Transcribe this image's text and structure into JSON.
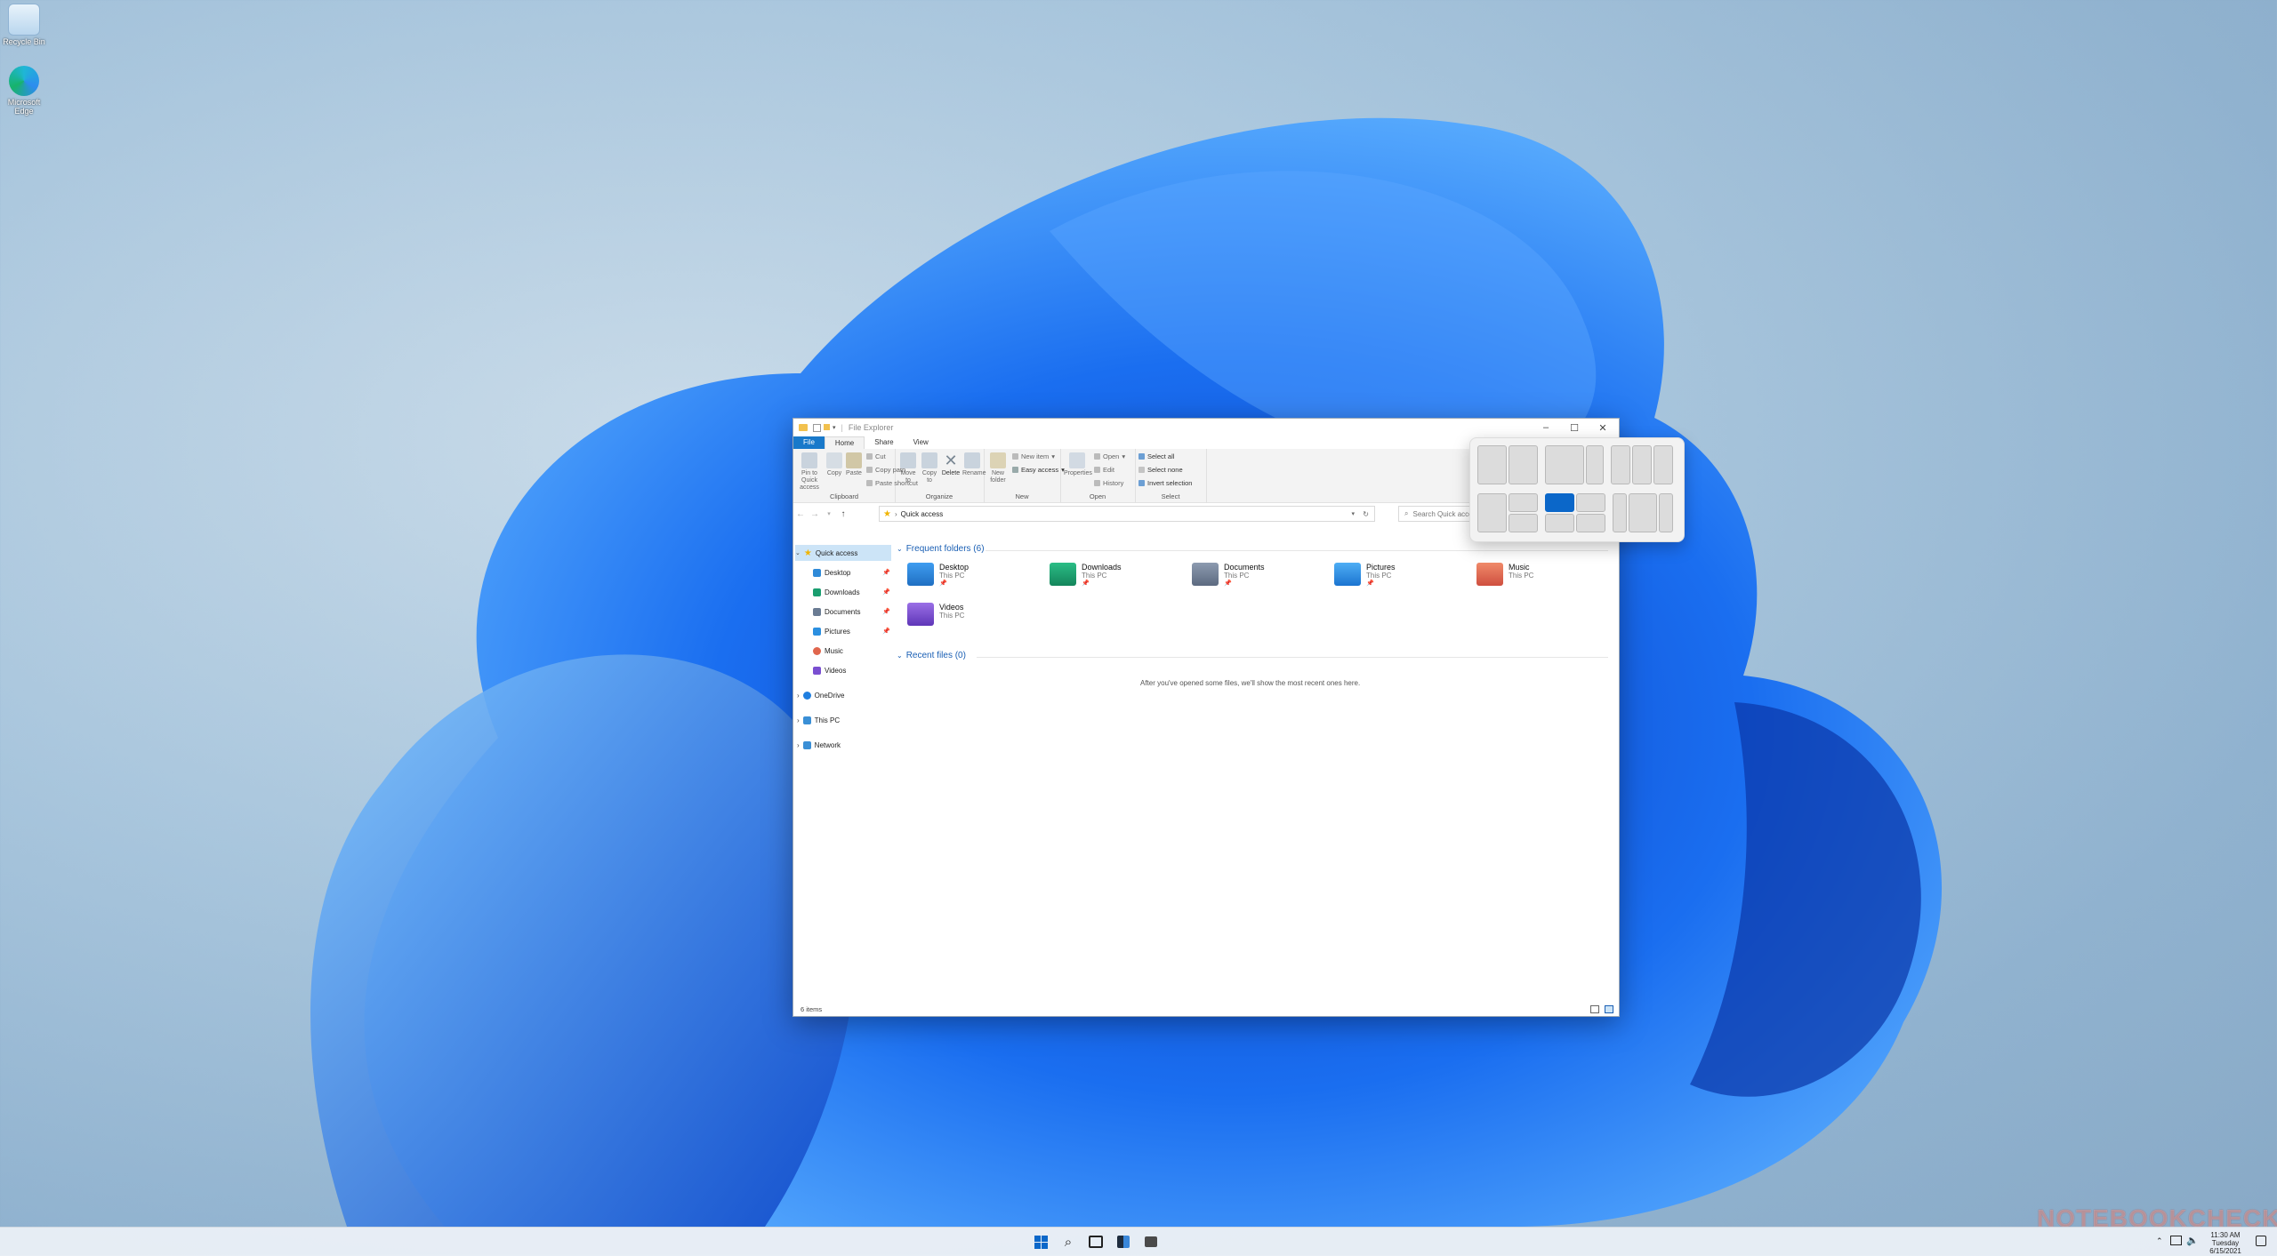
{
  "desktop": {
    "icons": [
      {
        "label": "Recycle Bin",
        "icon": "recycle-bin-icon"
      },
      {
        "label": "Microsoft Edge",
        "icon": "edge-icon"
      }
    ]
  },
  "window": {
    "title": "File Explorer",
    "tabs": [
      "File",
      "Home",
      "Share",
      "View"
    ],
    "ribbon": {
      "clipboard": {
        "label": "Clipboard",
        "pin_to_quick": "Pin to Quick access",
        "copy": "Copy",
        "paste": "Paste",
        "cut": "Cut",
        "copy_path": "Copy path",
        "paste_shortcut": "Paste shortcut"
      },
      "organize": {
        "label": "Organize",
        "move_to": "Move to",
        "copy_to": "Copy to",
        "delete": "Delete",
        "rename": "Rename"
      },
      "new": {
        "label": "New",
        "new_folder": "New folder",
        "new_item": "New item",
        "easy_access": "Easy access"
      },
      "open": {
        "label": "Open",
        "properties": "Properties",
        "open": "Open",
        "edit": "Edit",
        "history": "History"
      },
      "select": {
        "label": "Select",
        "select_all": "Select all",
        "select_none": "Select none",
        "invert": "Invert selection"
      }
    },
    "address": {
      "path": "Quick access",
      "search_placeholder": "Search Quick access"
    },
    "nav": {
      "quick_access": "Quick access",
      "items": [
        "Desktop",
        "Downloads",
        "Documents",
        "Pictures",
        "Music",
        "Videos"
      ],
      "onedrive": "OneDrive",
      "this_pc": "This PC",
      "network": "Network"
    },
    "content": {
      "frequent_header": "Frequent folders (6)",
      "recent_header": "Recent files (0)",
      "recent_empty": "After you've opened some files, we'll show the most recent ones here.",
      "folders": [
        {
          "name": "Desktop",
          "location": "This PC",
          "color": "#2f8ad8"
        },
        {
          "name": "Downloads",
          "location": "This PC",
          "color": "#1a9e6f"
        },
        {
          "name": "Documents",
          "location": "This PC",
          "color": "#6a7b93"
        },
        {
          "name": "Pictures",
          "location": "This PC",
          "color": "#2b8fe0"
        },
        {
          "name": "Music",
          "location": "This PC",
          "color": "#e0664d"
        },
        {
          "name": "Videos",
          "location": "This PC",
          "color": "#7a4fd1"
        }
      ]
    },
    "status": "6 items"
  },
  "taskbar": {
    "clock": {
      "time": "11:30 AM",
      "day": "Tuesday",
      "date": "6/15/2021"
    }
  },
  "colors": {
    "accent": "#0b67c9",
    "file_tab": "#1979ca"
  },
  "watermark": "NOTEBOOKCHECK"
}
